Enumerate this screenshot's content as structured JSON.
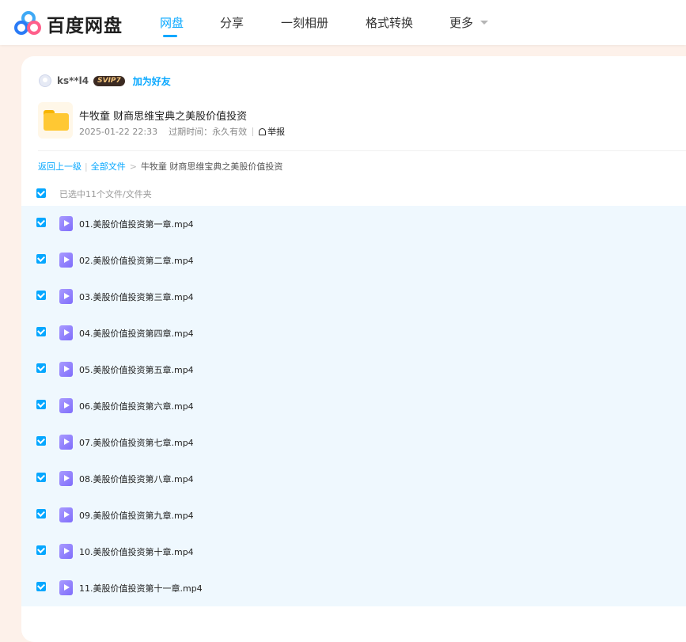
{
  "header": {
    "logo_text": "百度网盘",
    "nav": [
      {
        "label": "网盘",
        "active": true
      },
      {
        "label": "分享",
        "active": false
      },
      {
        "label": "一刻相册",
        "active": false
      },
      {
        "label": "格式转换",
        "active": false
      },
      {
        "label": "更多",
        "active": false
      }
    ],
    "accent_color": "#06a7ff"
  },
  "share": {
    "username": "ks**l4",
    "vip_badge": "SVIP7",
    "add_friend": "加为好友",
    "title": "牛牧童 财商思维宝典之美股价值投资",
    "date": "2025-01-22 22:33",
    "expiry": "过期时间：永久有效",
    "report": "举报"
  },
  "breadcrumb": {
    "back": "返回上一级",
    "all_files": "全部文件",
    "current": "牛牧童 财商思维宝典之美股价值投资"
  },
  "selection": {
    "text": "已选中11个文件/文件夹"
  },
  "files": [
    {
      "name": "01.美股价值投资第一章.mp4",
      "checked": true,
      "icon": "video-file-icon"
    },
    {
      "name": "02.美股价值投资第二章.mp4",
      "checked": true,
      "icon": "video-file-icon"
    },
    {
      "name": "03.美股价值投资第三章.mp4",
      "checked": true,
      "icon": "video-file-icon"
    },
    {
      "name": "04.美股价值投资第四章.mp4",
      "checked": true,
      "icon": "video-file-icon"
    },
    {
      "name": "05.美股价值投资第五章.mp4",
      "checked": true,
      "icon": "video-file-icon"
    },
    {
      "name": "06.美股价值投资第六章.mp4",
      "checked": true,
      "icon": "video-file-icon"
    },
    {
      "name": "07.美股价值投资第七章.mp4",
      "checked": true,
      "icon": "video-file-icon"
    },
    {
      "name": "08.美股价值投资第八章.mp4",
      "checked": true,
      "icon": "video-file-icon"
    },
    {
      "name": "09.美股价值投资第九章.mp4",
      "checked": true,
      "icon": "video-file-icon"
    },
    {
      "name": "10.美股价值投资第十章.mp4",
      "checked": true,
      "icon": "video-file-icon"
    },
    {
      "name": "11.美股价值投资第十一章.mp4",
      "checked": true,
      "icon": "video-file-icon"
    }
  ]
}
